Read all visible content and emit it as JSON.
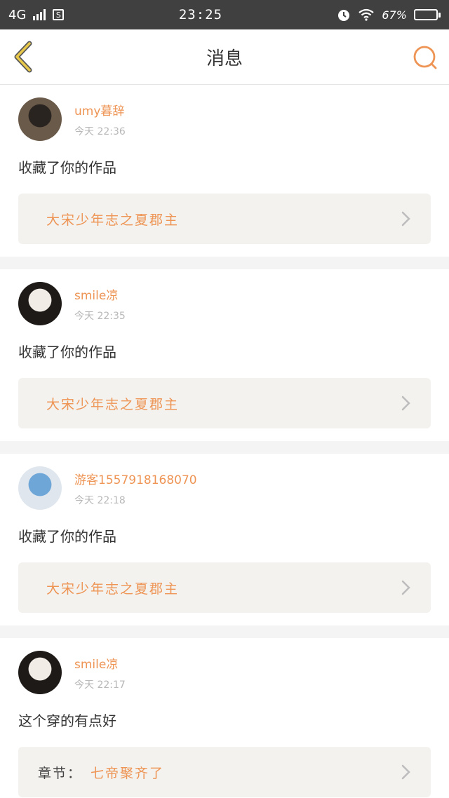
{
  "status_bar": {
    "network": "4G",
    "sim_icon": "sim-s-icon",
    "time": "23:25",
    "battery": "67%",
    "battery_level": 0.67
  },
  "nav": {
    "title": "消息"
  },
  "messages": [
    {
      "username": "umy暮辞",
      "time": "今天  22:36",
      "action": "收藏了你的作品",
      "ref_prefix": "",
      "ref_title": "大宋少年志之夏郡主",
      "avatar_colors": [
        "#2a2420",
        "#6a5a4a"
      ]
    },
    {
      "username": "smile凉",
      "time": "今天  22:35",
      "action": "收藏了你的作品",
      "ref_prefix": "",
      "ref_title": "大宋少年志之夏郡主",
      "avatar_colors": [
        "#f2ece6",
        "#1e1a18"
      ]
    },
    {
      "username": "游客1557918168070",
      "time": "今天  22:18",
      "action": "收藏了你的作品",
      "ref_prefix": "",
      "ref_title": "大宋少年志之夏郡主",
      "avatar_colors": [
        "#6fa6d8",
        "#dfe6ee"
      ]
    },
    {
      "username": "smile凉",
      "time": "今天  22:17",
      "action": "这个穿的有点好",
      "ref_prefix": "章节：",
      "ref_title": "七帝聚齐了",
      "avatar_colors": [
        "#f2ece6",
        "#1e1a18"
      ]
    }
  ],
  "colors": {
    "accent": "#ee9454",
    "back_icon_stroke": "#e8c84a"
  }
}
